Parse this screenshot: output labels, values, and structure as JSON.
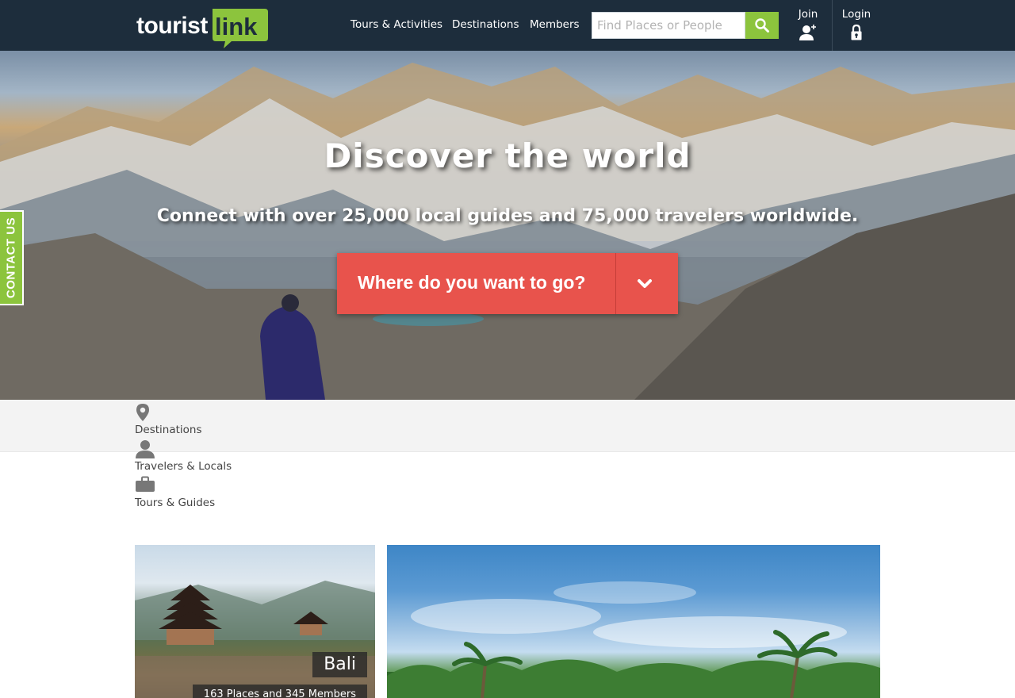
{
  "brand": {
    "name": "touristlink",
    "name_part1": "tourist",
    "name_part2": "link",
    "accent": "#8cc43d",
    "header_bg": "#1d2d3c"
  },
  "nav": {
    "tours": "Tours & Activities",
    "destinations": "Destinations",
    "members": "Members"
  },
  "search": {
    "placeholder": "Find Places or People",
    "icon": "magnifier-icon"
  },
  "header_actions": {
    "join": {
      "label": "Join",
      "icon": "add-user-icon"
    },
    "login": {
      "label": "Login",
      "icon": "lock-icon"
    }
  },
  "hero": {
    "title": "Discover the world",
    "subtitle": "Connect with over 25,000 local guides and 75,000 travelers worldwide.",
    "cta_label": "Where do you want to go?",
    "cta_icon": "chevron-down-icon",
    "cta_color": "#e8534c"
  },
  "contact_tab": {
    "label": "CONTACT US"
  },
  "categories": [
    {
      "label": "Destinations",
      "icon": "map-pin-icon"
    },
    {
      "label": "Travelers & Locals",
      "icon": "person-icon"
    },
    {
      "label": "Tours & Guides",
      "icon": "briefcase-icon"
    }
  ],
  "cards": [
    {
      "name": "Bali",
      "meta": "163 Places and 345 Members"
    },
    {
      "name": "",
      "meta": ""
    }
  ]
}
